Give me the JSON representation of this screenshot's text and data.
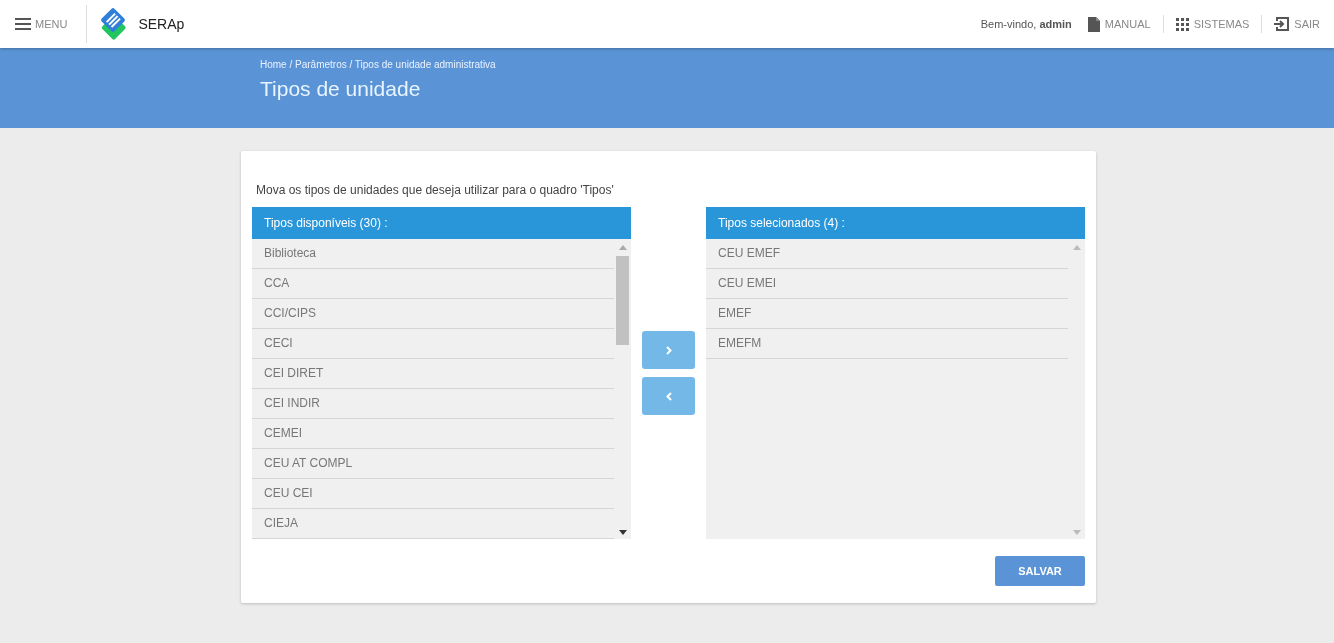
{
  "header": {
    "menu_label": "MENU",
    "app_name": "SERAp",
    "welcome": "Bem-vindo, **admin**",
    "links": [
      {
        "kind": "manual",
        "label": "MANUAL"
      },
      {
        "kind": "systems",
        "label": "SISTEMAS"
      },
      {
        "kind": "exit",
        "label": "SAIR"
      }
    ]
  },
  "banner": {
    "breadcrumb": "Home / Parâmetros / Tipos de unidade administrativa",
    "title": "Tipos de unidade"
  },
  "instruction": "Mova os tipos de unidades que deseja utilizar para o quadro 'Tipos'",
  "available": {
    "title": "Tipos disponíveis (30) :",
    "items": [
      "Biblioteca",
      "CCA",
      "CCI/CIPS",
      "CECI",
      "CEI DIRET",
      "CEI INDIR",
      "CEMEI",
      "CEU AT COMPL",
      "CEU CEI",
      "CIEJA"
    ]
  },
  "selected": {
    "title": "Tipos selecionados (4) :",
    "items": [
      "CEU EMEF",
      "CEU EMEI",
      "EMEF",
      "EMEFM"
    ]
  },
  "save_button": "SALVAR"
}
